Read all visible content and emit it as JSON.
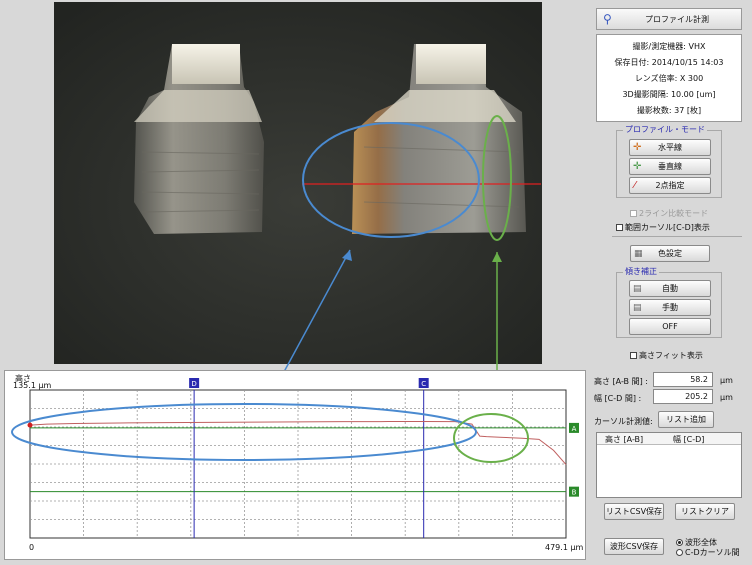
{
  "panel": {
    "title": "プロファイル計測",
    "info_lines": [
      "撮影/測定機器: VHX",
      "保存日付: 2014/10/15 14:03",
      "レンズ倍率: X 300",
      "3D撮影間隔: 10.00 [um]",
      "撮影枚数: 37 [枚]"
    ],
    "profile_mode": {
      "title": "プロファイル・モード",
      "horizontal": "水平線",
      "vertical": "垂直線",
      "two_point": "2点指定"
    },
    "two_line_compare": "2ライン比較モード",
    "range_cursor": "範囲カーソル[C-D]表示",
    "color_settings": "色設定",
    "tilt": {
      "title": "傾き補正",
      "auto": "自動",
      "manual": "手動",
      "off": "OFF"
    },
    "height_fit": "高さフィット表示"
  },
  "measure": {
    "height_label": "高さ [A-B 間] :",
    "height_value": "58.2",
    "height_unit": "μm",
    "width_label": "幅 [C-D 間] :",
    "width_value": "205.2",
    "width_unit": "μm",
    "cursor_label": "カーソル計測値:",
    "list_add": "リスト追加",
    "col_height": "高さ [A-B]",
    "col_width": "幅 [C-D]",
    "list_csv_save": "リストCSV保存",
    "list_clear": "リストクリア",
    "wave_csv_save": "波形CSV保存",
    "radio_all": "波形全体",
    "radio_cd": "C-Dカーソル間"
  },
  "chart": {
    "y_title": "高さ",
    "y_max": "135.1 μm",
    "x_min": "0",
    "x_max": "479.1 μm",
    "marker_c": "C",
    "marker_d": "D",
    "marker_a": "A",
    "marker_b": "B",
    "colors": {
      "profile": "#c06060",
      "cursor_ab": "#2a8a2a",
      "cursor_cd": "#2a2ab0",
      "blue_annot": "#4a8ad0",
      "green_annot": "#6ab04a"
    }
  },
  "chart_data": {
    "type": "line",
    "title": "",
    "xlabel": "",
    "ylabel": "高さ",
    "xlim": [
      0,
      479.1
    ],
    "ylim": [
      0,
      135.1
    ],
    "series": [
      {
        "x": [
          0,
          15,
          40,
          80,
          120,
          160,
          200,
          240,
          280,
          320,
          350,
          380,
          395,
          402,
          408,
          420,
          440,
          455,
          468,
          479.1
        ],
        "values": [
          103,
          104,
          104.5,
          105,
          105.3,
          105.6,
          105.8,
          106,
          106.2,
          106.3,
          106.4,
          106.2,
          104,
          93,
          92.5,
          92,
          91,
          90,
          80,
          67
        ]
      }
    ],
    "cursors": {
      "A": 100.5,
      "B": 42.3,
      "C": 351.9,
      "D": 146.7
    }
  }
}
